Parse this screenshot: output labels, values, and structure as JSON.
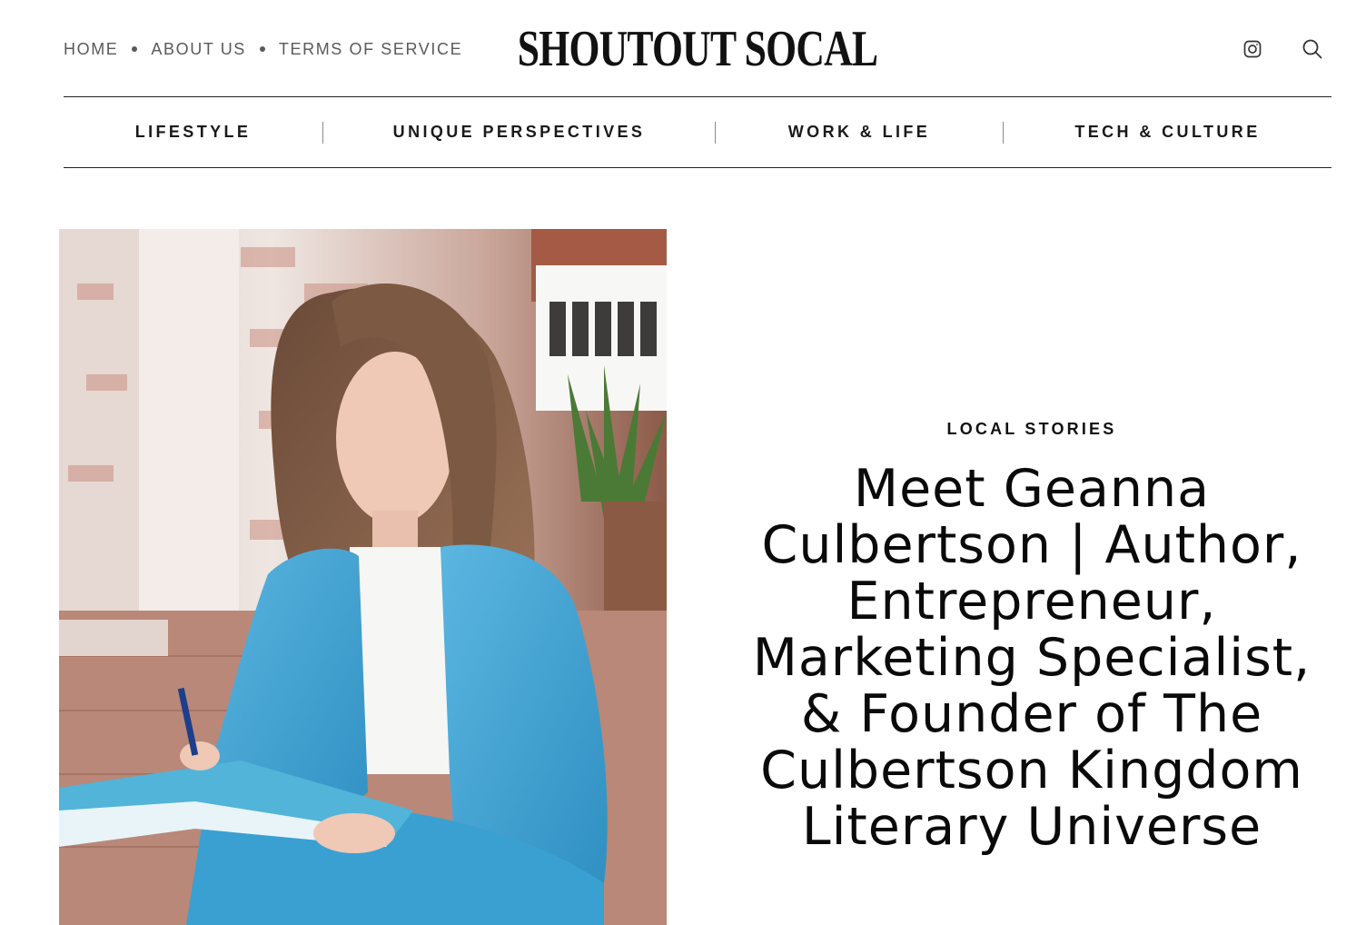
{
  "header": {
    "utility_nav": [
      {
        "label": "HOME"
      },
      {
        "label": "ABOUT US"
      },
      {
        "label": "TERMS OF SERVICE"
      }
    ],
    "brand": "SHOUTOUT SOCAL",
    "icons": [
      "instagram-icon",
      "search-icon"
    ]
  },
  "category_nav": [
    {
      "label": "LIFESTYLE"
    },
    {
      "label": "UNIQUE PERSPECTIVES"
    },
    {
      "label": "WORK & LIFE"
    },
    {
      "label": "TECH & CULTURE"
    }
  ],
  "article": {
    "category": "LOCAL STORIES",
    "title": "Meet Geanna Culbertson | Author, Entrepreneur, Marketing Specialist, & Founder of The Culbertson Kingdom Literary Universe"
  },
  "colors": {
    "text": "#111111",
    "muted_text": "#5a5a5a",
    "rule": "#222222",
    "background": "#ffffff",
    "blazer": "#3e9fcf"
  }
}
